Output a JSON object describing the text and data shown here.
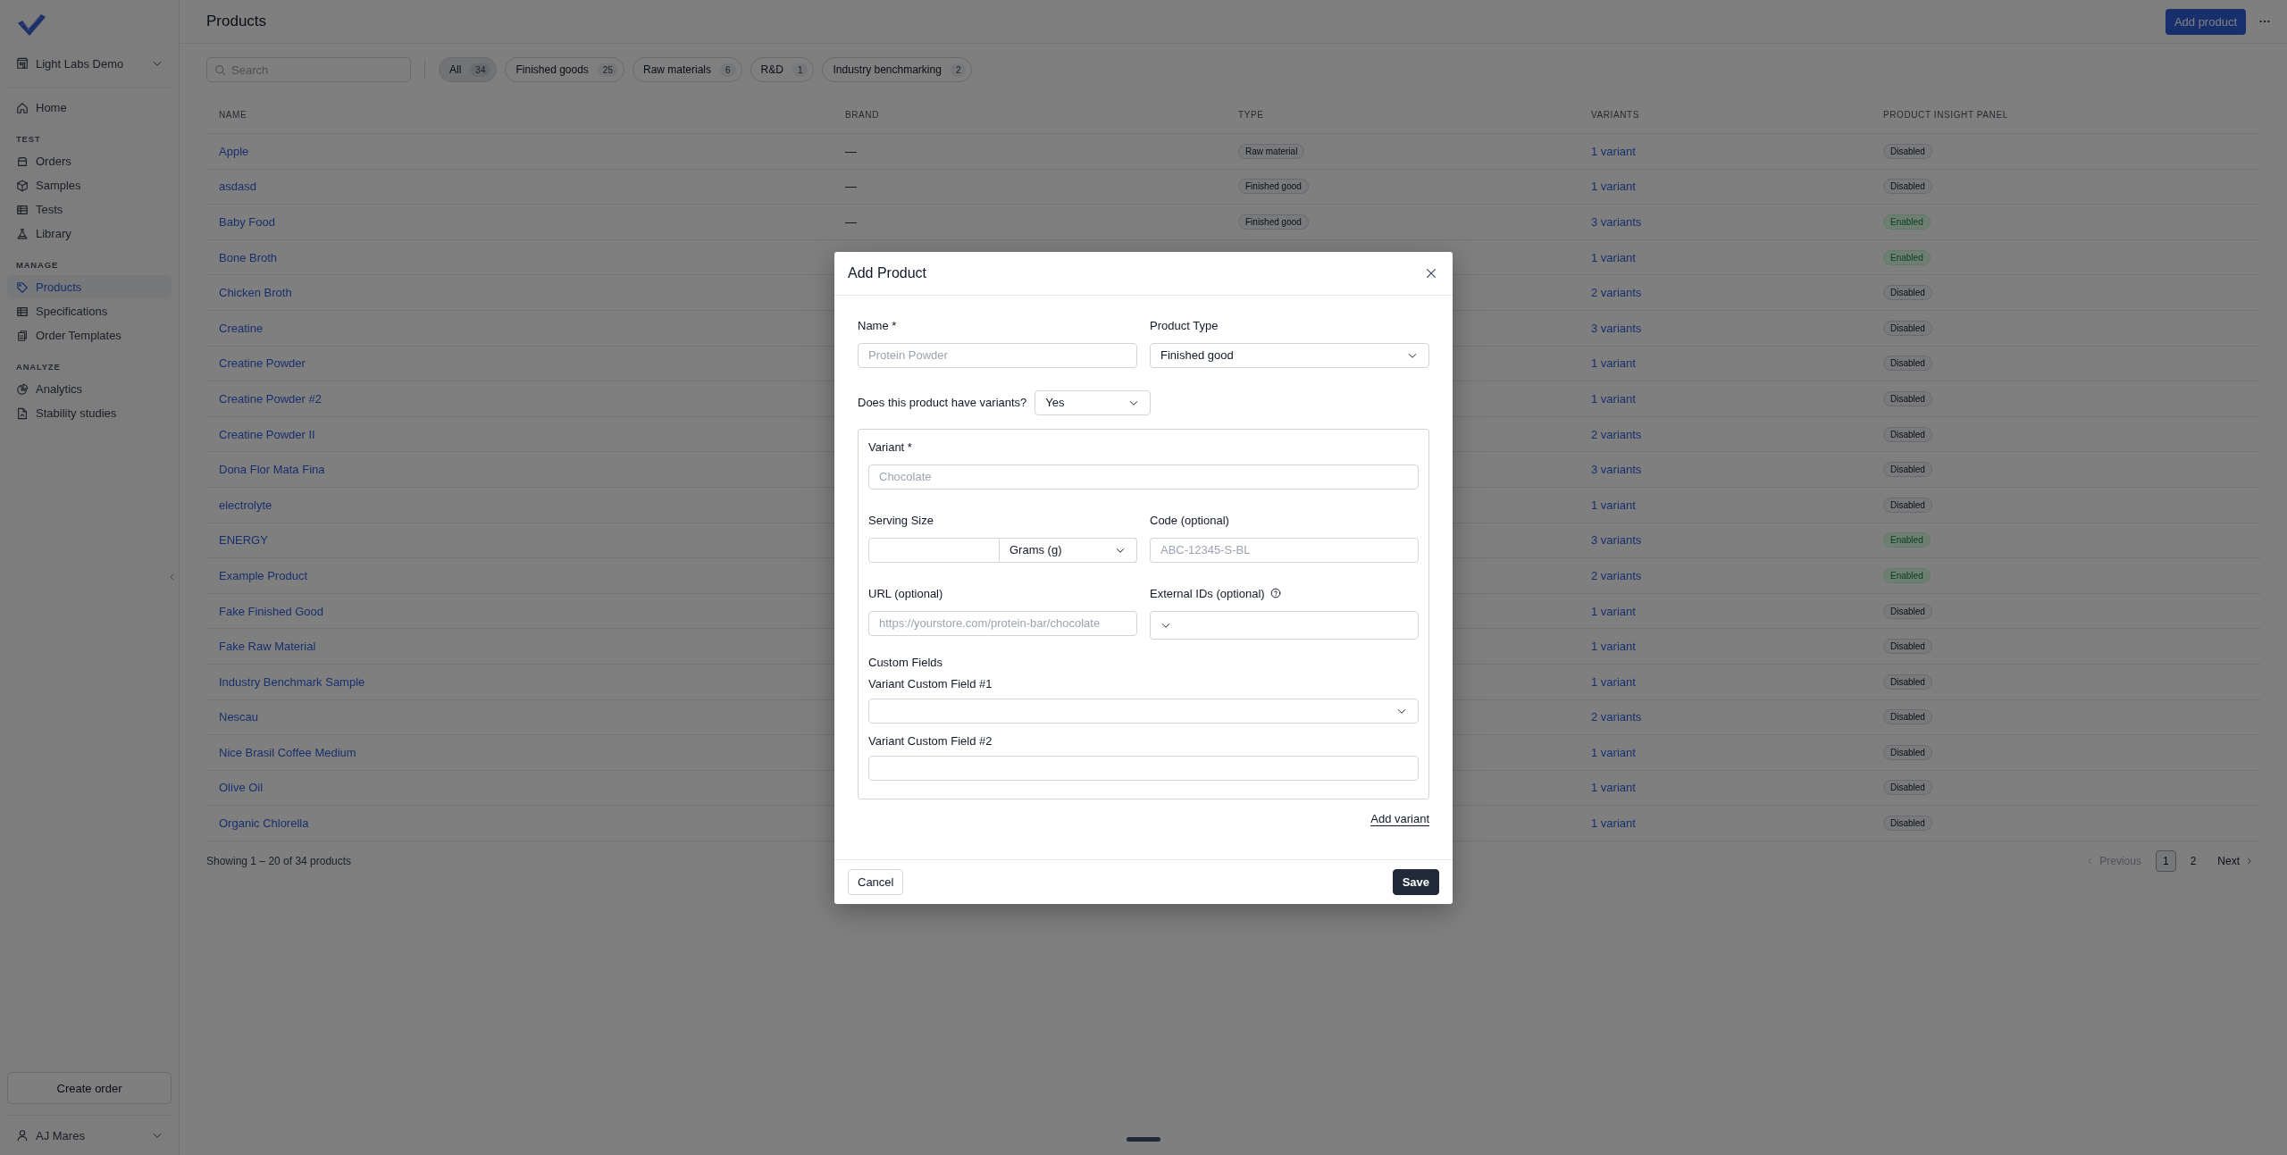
{
  "sidebar": {
    "workspace": "Light Labs Demo",
    "sections": [
      {
        "items": [
          {
            "label": "Home",
            "selected": false
          }
        ]
      },
      {
        "title": "TEST",
        "items": [
          {
            "label": "Orders",
            "selected": false
          },
          {
            "label": "Samples",
            "selected": false
          },
          {
            "label": "Tests",
            "selected": false
          },
          {
            "label": "Library",
            "selected": false
          }
        ]
      },
      {
        "title": "MANAGE",
        "items": [
          {
            "label": "Products",
            "selected": true
          },
          {
            "label": "Specifications",
            "selected": false
          },
          {
            "label": "Order Templates",
            "selected": false
          }
        ]
      },
      {
        "title": "ANALYZE",
        "items": [
          {
            "label": "Analytics",
            "selected": false
          },
          {
            "label": "Stability studies",
            "selected": false
          }
        ]
      }
    ],
    "create_button": "Create order",
    "user": "AJ Mares"
  },
  "header": {
    "title": "Products",
    "primary_button": "Add product"
  },
  "filters": {
    "search_placeholder": "Search",
    "chips": [
      {
        "label": "All",
        "count": "34",
        "selected": true
      },
      {
        "label": "Finished goods",
        "count": "25",
        "selected": false
      },
      {
        "label": "Raw materials",
        "count": "6",
        "selected": false
      },
      {
        "label": "R&D",
        "count": "1",
        "selected": false
      },
      {
        "label": "Industry benchmarking",
        "count": "2",
        "selected": false
      }
    ]
  },
  "table": {
    "columns": [
      "NAME",
      "BRAND",
      "TYPE",
      "VARIANTS",
      "PRODUCT INSIGHT PANEL"
    ],
    "rows": [
      {
        "name": "Apple",
        "brand": "—",
        "type": "Raw material",
        "variants": "1 variant",
        "panel": {
          "label": "Disabled",
          "enabled": false
        }
      },
      {
        "name": "asdasd",
        "brand": "—",
        "type": "Finished good",
        "variants": "1 variant",
        "panel": {
          "label": "Disabled",
          "enabled": false
        }
      },
      {
        "name": "Baby Food",
        "brand": "—",
        "type": "Finished good",
        "variants": "3 variants",
        "panel": {
          "label": "Enabled",
          "enabled": true
        }
      },
      {
        "name": "Bone Broth",
        "variants": "1 variant",
        "panel": {
          "label": "Enabled",
          "enabled": true
        }
      },
      {
        "name": "Chicken Broth",
        "variants": "2 variants",
        "panel": {
          "label": "Disabled",
          "enabled": false
        }
      },
      {
        "name": "Creatine",
        "variants": "3 variants",
        "panel": {
          "label": "Disabled",
          "enabled": false
        }
      },
      {
        "name": "Creatine Powder",
        "variants": "1 variant",
        "panel": {
          "label": "Disabled",
          "enabled": false
        }
      },
      {
        "name": "Creatine Powder #2",
        "variants": "1 variant",
        "panel": {
          "label": "Disabled",
          "enabled": false
        }
      },
      {
        "name": "Creatine Powder II",
        "variants": "2 variants",
        "panel": {
          "label": "Disabled",
          "enabled": false
        }
      },
      {
        "name": "Dona Flor Mata Fina",
        "variants": "3 variants",
        "panel": {
          "label": "Disabled",
          "enabled": false
        }
      },
      {
        "name": "electrolyte",
        "variants": "1 variant",
        "panel": {
          "label": "Disabled",
          "enabled": false
        }
      },
      {
        "name": "ENERGY",
        "variants": "3 variants",
        "panel": {
          "label": "Enabled",
          "enabled": true
        }
      },
      {
        "name": "Example Product",
        "variants": "2 variants",
        "panel": {
          "label": "Enabled",
          "enabled": true
        }
      },
      {
        "name": "Fake Finished Good",
        "variants": "1 variant",
        "panel": {
          "label": "Disabled",
          "enabled": false
        }
      },
      {
        "name": "Fake Raw Material",
        "variants": "1 variant",
        "panel": {
          "label": "Disabled",
          "enabled": false
        }
      },
      {
        "name": "Industry Benchmark Sample",
        "variants": "1 variant",
        "panel": {
          "label": "Disabled",
          "enabled": false
        }
      },
      {
        "name": "Nescau",
        "variants": "2 variants",
        "panel": {
          "label": "Disabled",
          "enabled": false
        }
      },
      {
        "name": "Nice Brasil Coffee Medium",
        "variants": "1 variant",
        "panel": {
          "label": "Disabled",
          "enabled": false
        }
      },
      {
        "name": "Olive Oil",
        "variants": "1 variant",
        "panel": {
          "label": "Disabled",
          "enabled": false
        }
      },
      {
        "name": "Organic Chlorella",
        "variants": "1 variant",
        "panel": {
          "label": "Disabled",
          "enabled": false
        }
      }
    ]
  },
  "footer": {
    "summary": "Showing 1 – 20 of 34 products",
    "previous": {
      "label": "Previous",
      "disabled": true
    },
    "pages": [
      {
        "label": "1",
        "selected": true
      },
      {
        "label": "2",
        "selected": false
      }
    ],
    "next": "Next"
  },
  "modal": {
    "title": "Add Product",
    "name": {
      "label": "Name *",
      "placeholder": "Protein Powder"
    },
    "product_type": {
      "label": "Product Type",
      "value": "Finished good"
    },
    "has_variants": {
      "label": "Does this product have variants?",
      "value": "Yes"
    },
    "variant": {
      "label": "Variant *",
      "placeholder": "Chocolate"
    },
    "serving_size": {
      "label": "Serving Size",
      "unit": "Grams (g)"
    },
    "code": {
      "label": "Code (optional)",
      "placeholder": "ABC-12345-S-BL"
    },
    "url": {
      "label": "URL (optional)",
      "placeholder": "https://yourstore.com/protein-bar/chocolate"
    },
    "external_ids": {
      "label": "External IDs (optional)"
    },
    "custom_fields": {
      "title": "Custom Fields",
      "fields": [
        {
          "label": "Variant Custom Field #1",
          "kind": "select"
        },
        {
          "label": "Variant Custom Field #2",
          "kind": "text"
        }
      ]
    },
    "add_variant": "Add variant",
    "cancel": "Cancel",
    "save": "Save"
  }
}
